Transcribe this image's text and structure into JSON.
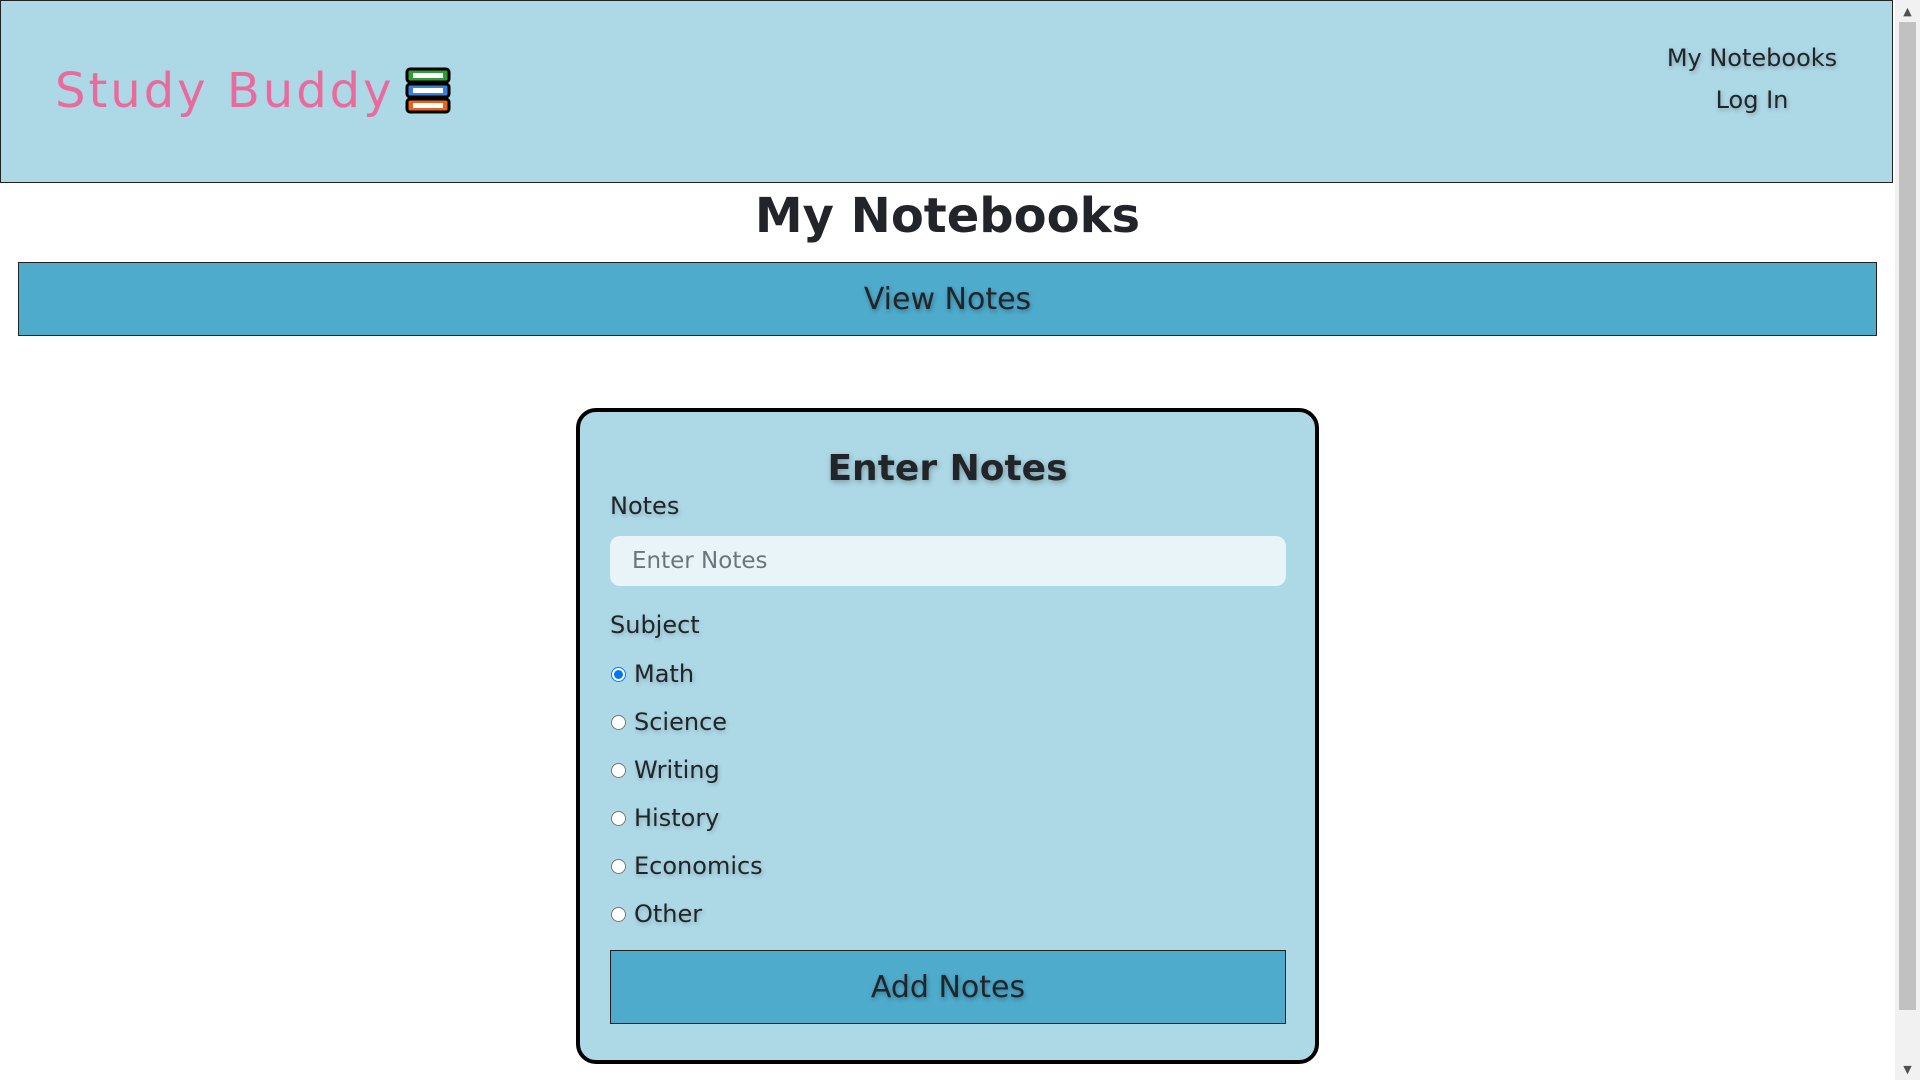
{
  "header": {
    "brand": "Study Buddy",
    "brand_icon": "books-icon",
    "nav": {
      "notebooks": "My Notebooks",
      "login": "Log In"
    }
  },
  "page": {
    "title": "My Notebooks",
    "view_notes": "View Notes"
  },
  "form": {
    "title": "Enter Notes",
    "notes_label": "Notes",
    "notes_placeholder": "Enter Notes",
    "notes_value": "",
    "subject_label": "Subject",
    "subjects": [
      "Math",
      "Science",
      "Writing",
      "History",
      "Economics",
      "Other"
    ],
    "selected_subject": "Math",
    "submit": "Add Notes"
  },
  "colors": {
    "header_bg": "#add8e6",
    "brand": "#e96b9d",
    "button_bg": "#4eabcc"
  }
}
